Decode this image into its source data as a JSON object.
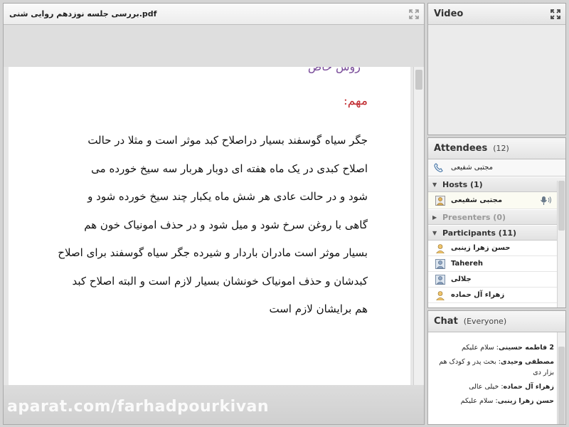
{
  "share": {
    "doc_title": "بررسی جلسه نوزدهم روایی شنی.pdf",
    "clipped_top_text": "روش خاص",
    "heading": "مهم:",
    "body_lines": [
      "جگر سیاه گوسفند بسیار دراصلاح کبد موثر است و مثلا در حالت",
      "اصلاح کبدی  در یک ماه هفته ای دوبار هربار سه سیخ خورده می",
      "شود و در حالت عادی هر شش ماه یکبار چند سیخ خورده شود و",
      "گاهی با روغن سرخ شود و میل شود و در حذف امونیاک خون هم",
      "بسیار موثر است مادران باردار و شیرده جگر سیاه گوسفند برای اصلاح",
      "کبدشان و حذف امونیاک خونشان بسیار لازم است و البته اصلاح کبد",
      "هم برایشان لازم است"
    ]
  },
  "watermark": "aparat.com/farhadpourkivan",
  "video": {
    "title": "Video"
  },
  "attendees": {
    "title": "Attendees",
    "count": "(12)",
    "me": "مجتبی شفیعی",
    "hosts_label": "Hosts (1)",
    "host_name": "مجتبی شفیعی",
    "presenters_label": "Presenters (0)",
    "participants_label": "Participants (11)",
    "participants": [
      "حسن زهرا زینبی",
      "Tahereh",
      "جلالی",
      "زهراء آل حماده"
    ]
  },
  "chat": {
    "title": "Chat",
    "scope": "(Everyone)",
    "messages": [
      {
        "sender": "2 فاطمه حسینی",
        "text": "سلام علیکم"
      },
      {
        "sender": "مصطفی وحیدی",
        "text": "بحث پدر و کودک هم بزار دی"
      },
      {
        "sender": "زهراء آل حماده",
        "text": "خیلی عالی"
      },
      {
        "sender": "حسن زهرا زینبی",
        "text": "سلام علیکم"
      }
    ]
  },
  "colors": {
    "heading": "#c0282d",
    "clip": "#7a4d9a",
    "pod_border": "#a9a9a9"
  }
}
